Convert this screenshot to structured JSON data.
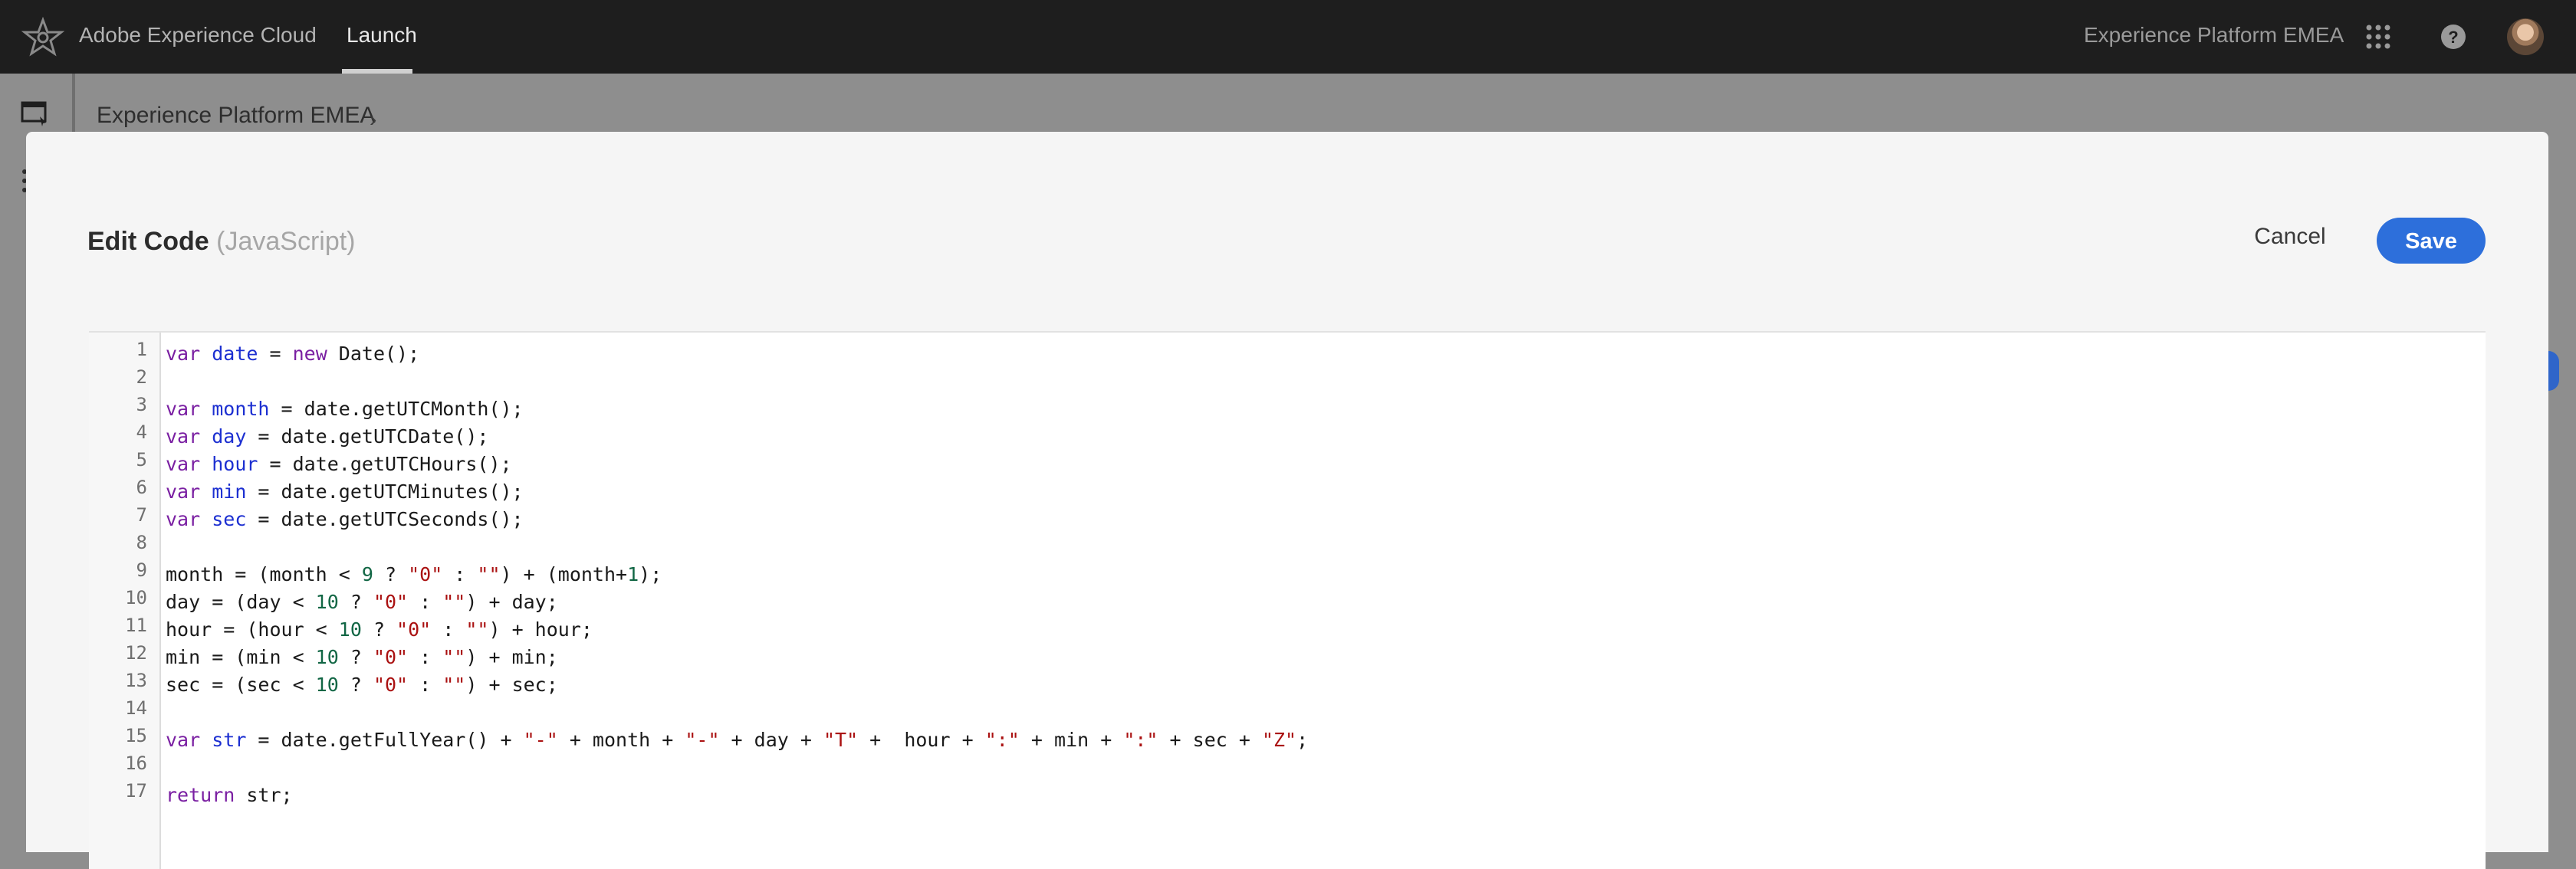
{
  "header": {
    "app_name": "Adobe Experience Cloud",
    "active_tab": "Launch",
    "org_name": "Experience Platform EMEA",
    "icons": [
      "adobe-logo-icon",
      "apps-grid-icon",
      "help-icon",
      "avatar"
    ]
  },
  "page": {
    "breadcrumb": "Experience Platform EMEA",
    "breadcrumb_separator": "›"
  },
  "modal": {
    "title": "Edit Code",
    "language": "(JavaScript)",
    "cancel_label": "Cancel",
    "save_label": "Save",
    "accent_color": "#2d6fdb"
  },
  "editor": {
    "line_numbers": [
      "1",
      "2",
      "3",
      "4",
      "5",
      "6",
      "7",
      "8",
      "9",
      "10",
      "11",
      "12",
      "13",
      "14",
      "15",
      "16",
      "17"
    ],
    "lines": [
      [
        [
          "kw",
          "var"
        ],
        [
          "p",
          " "
        ],
        [
          "var",
          "date"
        ],
        [
          "p",
          " = "
        ],
        [
          "kw",
          "new"
        ],
        [
          "p",
          " Date();"
        ]
      ],
      [],
      [
        [
          "kw",
          "var"
        ],
        [
          "p",
          " "
        ],
        [
          "var",
          "month"
        ],
        [
          "p",
          " = date.getUTCMonth();"
        ]
      ],
      [
        [
          "kw",
          "var"
        ],
        [
          "p",
          " "
        ],
        [
          "var",
          "day"
        ],
        [
          "p",
          " = date.getUTCDate();"
        ]
      ],
      [
        [
          "kw",
          "var"
        ],
        [
          "p",
          " "
        ],
        [
          "var",
          "hour"
        ],
        [
          "p",
          " = date.getUTCHours();"
        ]
      ],
      [
        [
          "kw",
          "var"
        ],
        [
          "p",
          " "
        ],
        [
          "var",
          "min"
        ],
        [
          "p",
          " = date.getUTCMinutes();"
        ]
      ],
      [
        [
          "kw",
          "var"
        ],
        [
          "p",
          " "
        ],
        [
          "var",
          "sec"
        ],
        [
          "p",
          " = date.getUTCSeconds();"
        ]
      ],
      [],
      [
        [
          "p",
          "month = (month < "
        ],
        [
          "num",
          "9"
        ],
        [
          "p",
          " ? "
        ],
        [
          "str",
          "\"0\""
        ],
        [
          "p",
          " : "
        ],
        [
          "str",
          "\"\""
        ],
        [
          "p",
          ") + (month+"
        ],
        [
          "num",
          "1"
        ],
        [
          "p",
          ");"
        ]
      ],
      [
        [
          "p",
          "day = (day < "
        ],
        [
          "num",
          "10"
        ],
        [
          "p",
          " ? "
        ],
        [
          "str",
          "\"0\""
        ],
        [
          "p",
          " : "
        ],
        [
          "str",
          "\"\""
        ],
        [
          "p",
          ") + day;"
        ]
      ],
      [
        [
          "p",
          "hour = (hour < "
        ],
        [
          "num",
          "10"
        ],
        [
          "p",
          " ? "
        ],
        [
          "str",
          "\"0\""
        ],
        [
          "p",
          " : "
        ],
        [
          "str",
          "\"\""
        ],
        [
          "p",
          ") + hour;"
        ]
      ],
      [
        [
          "p",
          "min = (min < "
        ],
        [
          "num",
          "10"
        ],
        [
          "p",
          " ? "
        ],
        [
          "str",
          "\"0\""
        ],
        [
          "p",
          " : "
        ],
        [
          "str",
          "\"\""
        ],
        [
          "p",
          ") + min;"
        ]
      ],
      [
        [
          "p",
          "sec = (sec < "
        ],
        [
          "num",
          "10"
        ],
        [
          "p",
          " ? "
        ],
        [
          "str",
          "\"0\""
        ],
        [
          "p",
          " : "
        ],
        [
          "str",
          "\"\""
        ],
        [
          "p",
          ") + sec;"
        ]
      ],
      [],
      [
        [
          "kw",
          "var"
        ],
        [
          "p",
          " "
        ],
        [
          "var",
          "str"
        ],
        [
          "p",
          " = date.getFullYear() + "
        ],
        [
          "str",
          "\"-\""
        ],
        [
          "p",
          " + month + "
        ],
        [
          "str",
          "\"-\""
        ],
        [
          "p",
          " + day + "
        ],
        [
          "str",
          "\"T\""
        ],
        [
          "p",
          " +  hour + "
        ],
        [
          "str",
          "\":\""
        ],
        [
          "p",
          " + min + "
        ],
        [
          "str",
          "\":\""
        ],
        [
          "p",
          " + sec + "
        ],
        [
          "str",
          "\"Z\""
        ],
        [
          "p",
          ";"
        ]
      ],
      [],
      [
        [
          "kw",
          "return"
        ],
        [
          "p",
          " str;"
        ]
      ]
    ]
  }
}
